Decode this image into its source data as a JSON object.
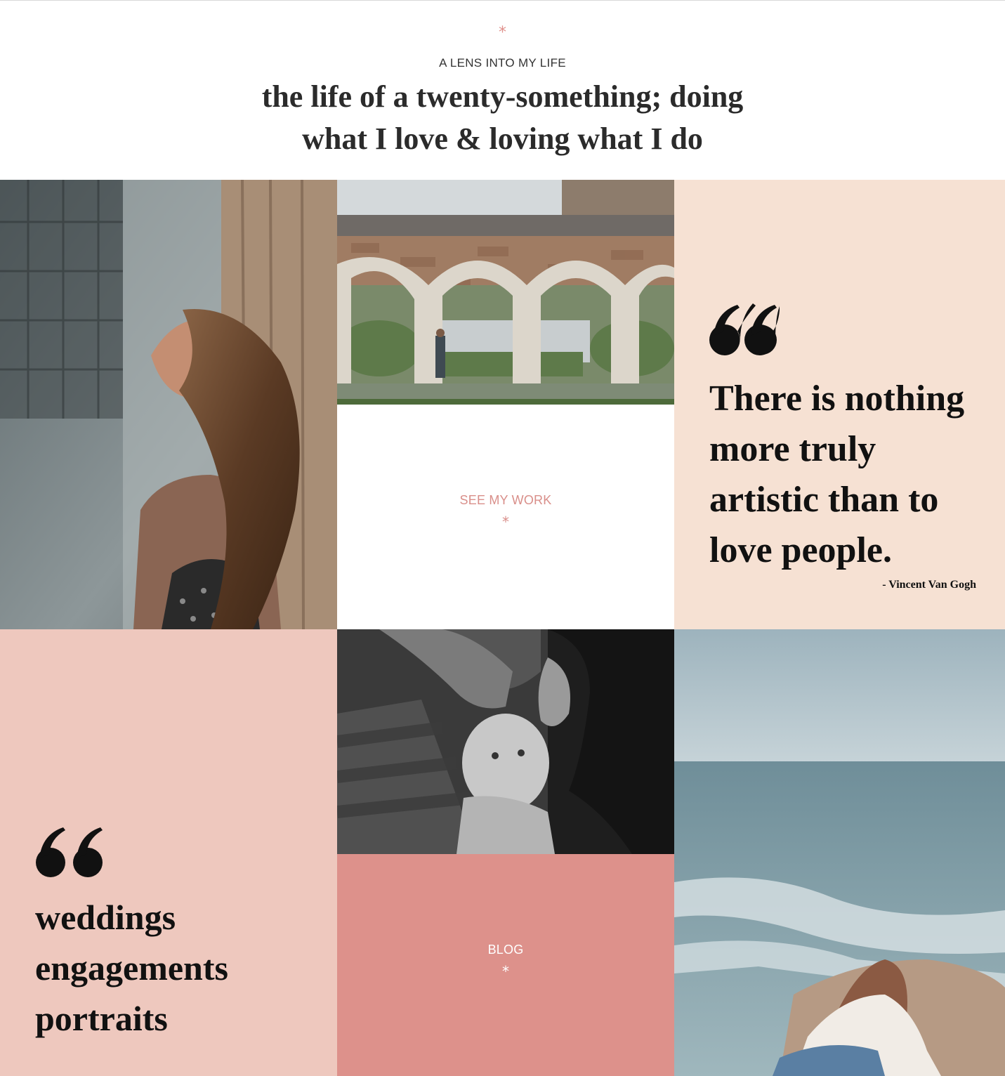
{
  "header": {
    "asterisk": "*",
    "eyebrow": "A LENS INTO MY LIFE",
    "headline": "the life of a twenty-something; doing what I love & loving what I do"
  },
  "tiles": {
    "see_work": {
      "label": "SEE MY WORK",
      "asterisk": "*"
    },
    "quote": {
      "text": "There is nothing more truly artistic than to love people.",
      "author": "- Vincent Van Gogh"
    },
    "services": {
      "items": [
        "weddings",
        "engagements",
        "portraits"
      ]
    },
    "blog": {
      "label": "BLOG",
      "asterisk": "*"
    }
  },
  "colors": {
    "accent": "#e0908b",
    "peach": "#f6e1d3",
    "blush": "#eec8be",
    "rose": "#dd918b"
  }
}
